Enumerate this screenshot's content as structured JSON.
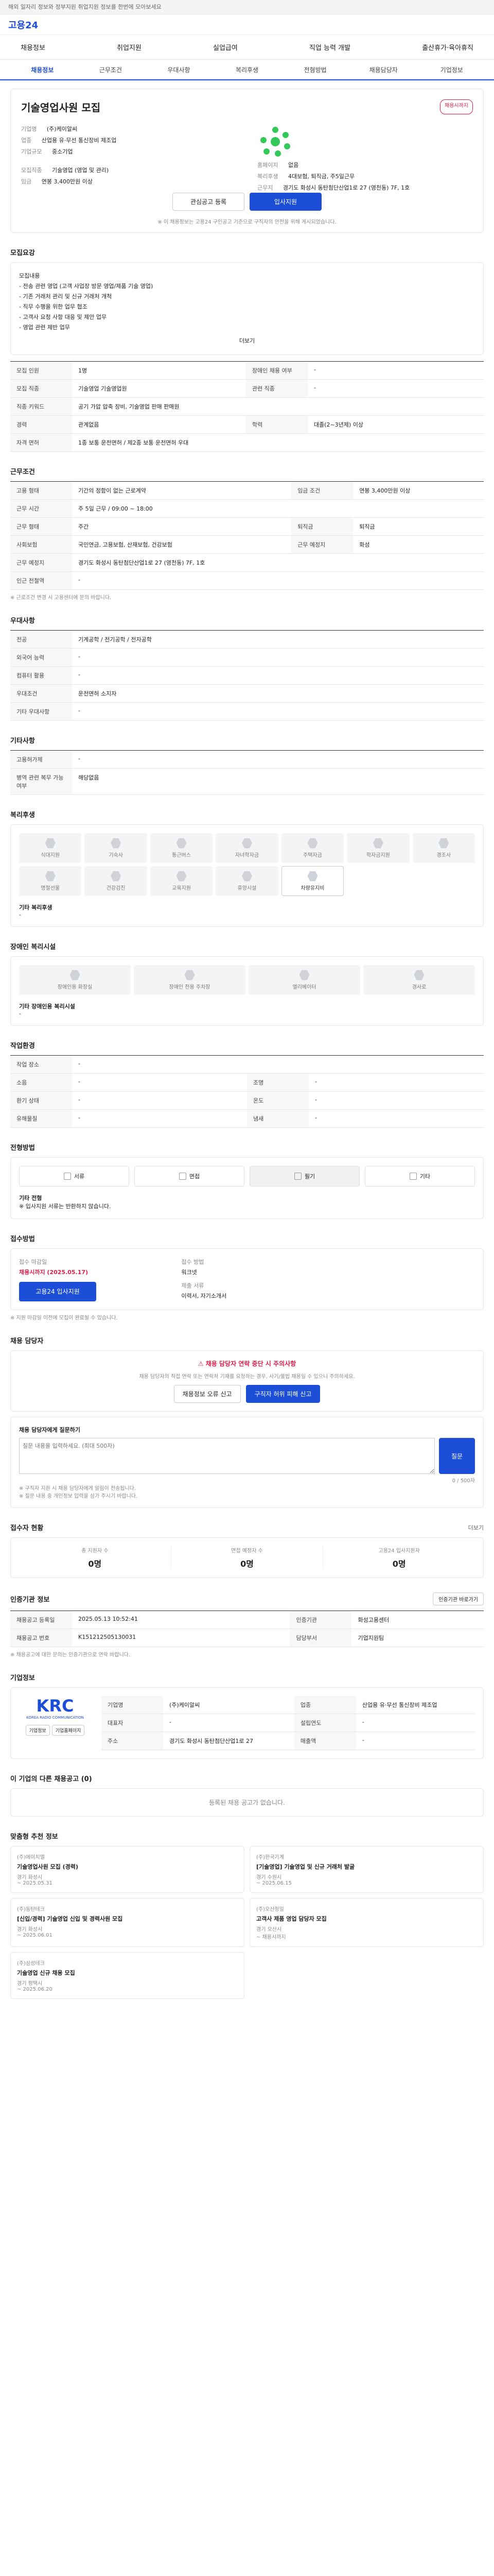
{
  "notice": "해외 일자리 정보와 정부지원 취업지원 정보를 한번에 모아보세요",
  "brand": "고용24",
  "gnb": [
    "채용정보",
    "취업지원",
    "실업급여",
    "직업 능력 개발",
    "출산휴가·육아휴직"
  ],
  "subnav": [
    "채용정보",
    "근무조건",
    "우대사항",
    "복리후생",
    "전형방법",
    "채용담당자",
    "기업정보"
  ],
  "job": {
    "title": "기술영업사원 모집",
    "status": "채용시까지",
    "company_label": "기업명",
    "company": "(주)케이알씨",
    "field_label": "업종",
    "field": "산업용 유·무선 통신장비 제조업",
    "size_label": "기업규모",
    "size": "중소기업",
    "url_label": "홈페이지",
    "url": "없음",
    "welfare_label": "복리후생",
    "welfare": "4대보험, 퇴직금, 주5일근무",
    "address_label": "근무지",
    "address": "경기도 화성시 동탄첨단산업1로 27 (영천동) 7F, 1호",
    "condition_label": "모집직종",
    "condition": "기술영업 (영업 및 관리)",
    "wage_label": "임금",
    "wage": "연봉 3,400만원 이상",
    "apply_btn": "입사지원",
    "scrap_btn": "관심공고 등록",
    "notice": "※ 이 채용정보는 고용24 구인공고 기준으로 구직자의 안전을 위해 게시되었습니다."
  },
  "requirements": {
    "title": "모집요강",
    "desc": [
      "모집내용",
      "- 전송 관련 영업 (고객 사업장 방문 영업/제품 기술 영업)",
      "- 기존 거래처 관리 및 신규 거래처 개척",
      "- 직무 수행을 위한 업무 협조",
      "- 고객사 요청 사항 대응 및 제안 업무",
      "- 영업 관련 제반 업무"
    ],
    "more": "더보기",
    "rows": [
      {
        "k": "모집 인원",
        "v": "1명",
        "k2": "장애인 채용 여부",
        "v2": "-"
      },
      {
        "k": "모집 직종",
        "v": "기술영업 기술영업원",
        "k2": "관련 직종",
        "v2": "-"
      },
      {
        "k": "직종 키워드",
        "v": "공기 가압 압축 장비, 기술영업 판매 판매원",
        "k2": "",
        "v2": ""
      },
      {
        "k": "경력",
        "v": "관계없음",
        "k2": "학력",
        "v2": "대졸(2~3년제) 이상"
      },
      {
        "k": "자격 면허",
        "v": "1종 보통 운전면허 / 제2종 보통 운전면허 우대",
        "k2": "",
        "v2": ""
      }
    ]
  },
  "conditions": {
    "title": "근무조건",
    "rows": [
      {
        "k": "고용 형태",
        "v": "기간의 정함이 없는 근로계약",
        "k2": "임금 조건",
        "v2": "연봉 3,400만원 이상"
      },
      {
        "k": "근무 시간",
        "v": "주 5일 근무 / 09:00 ~ 18:00",
        "k2": "",
        "v2": ""
      },
      {
        "k": "근무 형태",
        "v": "주간",
        "k2": "퇴직금",
        "v2": "퇴직금"
      },
      {
        "k": "사회보험",
        "v": "국민연금, 고용보험, 산재보험, 건강보험",
        "k2": "근무 예정지",
        "v2": "화성"
      },
      {
        "k": "근무 예정지",
        "v": "경기도 화성시 동탄첨단산업1로 27 (영천동) 7F, 1호",
        "k2": "",
        "v2": ""
      },
      {
        "k": "인근 전철역",
        "v": "-",
        "k2": "",
        "v2": ""
      }
    ],
    "note": "※ 근로조건 변경 시 고용센터에 문의 바랍니다."
  },
  "preference": {
    "title": "우대사항",
    "rows": [
      {
        "k": "전공",
        "v": "기계공학 / 전기공학 / 전자공학"
      },
      {
        "k": "외국어 능력",
        "v": "-"
      },
      {
        "k": "컴퓨터 활용",
        "v": "-"
      },
      {
        "k": "우대조건",
        "v": "운전면허 소지자"
      },
      {
        "k": "기타 우대사항",
        "v": "-"
      }
    ]
  },
  "etc": {
    "title": "기타사항",
    "rows": [
      {
        "k": "고용허가제",
        "v": "-"
      },
      {
        "k": "병역 관련 복무 가능 여부",
        "v": "해당없음"
      }
    ]
  },
  "welfare": {
    "title": "복리후생",
    "items": [
      "식대지원",
      "기숙사",
      "통근버스",
      "자녀학자금",
      "주택자금",
      "학자금지원",
      "경조사",
      "명절선물",
      "건강검진",
      "교육지원",
      "휴양시설",
      "차량유지비"
    ],
    "on_index": 11,
    "extra_label": "기타 복리후생",
    "extra": "-"
  },
  "disability": {
    "title": "장애인 복리시설",
    "items": [
      "장애인용 화장실",
      "장애인 전용 주차장",
      "엘리베이터",
      "경사로"
    ],
    "extra_label": "기타 장애인용 복리시설",
    "extra": "-"
  },
  "workplace": {
    "title": "작업환경",
    "rows": [
      {
        "k": "작업 장소",
        "v": "-",
        "k2": "",
        "v2": ""
      },
      {
        "k": "소음",
        "v": "-",
        "k2": "조명",
        "v2": "-"
      },
      {
        "k": "환기 상태",
        "v": "-",
        "k2": "온도",
        "v2": "-"
      },
      {
        "k": "유해물질",
        "v": "-",
        "k2": "냄새",
        "v2": "-"
      }
    ]
  },
  "process": {
    "title": "전형방법",
    "methods": [
      "서류",
      "면접",
      "필기",
      "기타"
    ],
    "on_index": 2,
    "extra_label": "기타 전형",
    "extra": "※ 입사지원 서류는 반환하지 않습니다."
  },
  "submission": {
    "title": "접수방법",
    "date_label": "접수 마감일",
    "date": "채용시까지 (2025.05.17)",
    "method_label": "접수 방법",
    "method": "워크넷",
    "docs_label": "제출 서류",
    "docs": "이력서, 자기소개서",
    "apply_btn": "고용24 입사지원",
    "note": "※ 지원 마감일 이전에 모집이 완료될 수 있습니다."
  },
  "contact": {
    "title": "채용 담당자",
    "warn": "채용 담당자 연락 중단 시 주의사항",
    "warn_desc": "채용 담당자의 직접 연락 또는 연락처 기재를 요청하는 경우, 사기/불법 채용일 수 있으니 주의하세요.",
    "btn1": "채용정보 오류 신고",
    "btn2": "구직자 허위 피해 신고",
    "ask_title": "채용 담당자에게 질문하기",
    "ask_placeholder": "질문 내용을 입력하세요. (최대 500자)",
    "counter": "0 / 500자",
    "ask_btn": "질문",
    "guide": [
      "※ 구직자 지원 시 채용 담당자에게 알림이 전송됩니다.",
      "※ 질문 내용 중 개인정보 입력을 삼가 주시기 바랍니다."
    ]
  },
  "applicants": {
    "title": "접수자 현황",
    "more": "더보기",
    "items": [
      {
        "label": "총 지원자 수",
        "value": "0명"
      },
      {
        "label": "면접 예정자 수",
        "value": "0명"
      },
      {
        "label": "고용24 입사지원자",
        "value": "0명"
      }
    ]
  },
  "manage": {
    "title": "인증기관 정보",
    "btn": "인증기관 바로가기",
    "rows": [
      {
        "k": "채용공고 등록일",
        "v": "2025.05.13 10:52:41",
        "k2": "인증기관",
        "v2": "화성고용센터"
      },
      {
        "k": "채용공고 번호",
        "v": "K151212505130031",
        "k2": "담당부서",
        "v2": "기업지원팀"
      }
    ],
    "note": "※ 채용공고에 대한 문의는 인증기관으로 연락 바랍니다."
  },
  "company": {
    "title": "기업정보",
    "logo": "KRC",
    "logo_sub": "KOREA RADIO COMMUNICATION",
    "rows": [
      {
        "k": "기업명",
        "v": "(주)케이알씨",
        "k2": "업종",
        "v2": "산업용 유·무선 통신장비 제조업"
      },
      {
        "k": "대표자",
        "v": "-",
        "k2": "설립연도",
        "v2": "-"
      },
      {
        "k": "주소",
        "v": "경기도 화성시 동탄첨단산업1로 27",
        "k2": "매출액",
        "v2": "-"
      }
    ],
    "btn1": "기업정보",
    "btn2": "기업홈페이지"
  },
  "same_company": {
    "title": "이 기업의 다른 채용공고 (0)",
    "empty": "등록된 채용 공고가 없습니다."
  },
  "recommend": {
    "title": "맞춤형 추천 정보",
    "items": [
      {
        "company": "(주)에이치엘",
        "title": "기술영업사원 모집 (경력)",
        "loc": "경기 화성시",
        "date": "~ 2025.05.31"
      },
      {
        "company": "(주)한국기계",
        "title": "[기술영업] 기술영업 및 신규 거래처 발굴",
        "loc": "경기 수원시",
        "date": "~ 2025.06.15"
      },
      {
        "company": "(주)동탄테크",
        "title": "[신입/경력] 기술영업 신입 및 경력사원 모집",
        "loc": "경기 화성시",
        "date": "~ 2025.06.01"
      },
      {
        "company": "(주)오산정밀",
        "title": "고객사 제품 영업 담당자 모집",
        "loc": "경기 오산시",
        "date": "~ 채용시까지"
      },
      {
        "company": "(주)삼성테크",
        "title": "기술영업 신규 채용 모집",
        "loc": "경기 평택시",
        "date": "~ 2025.06.20"
      }
    ]
  }
}
